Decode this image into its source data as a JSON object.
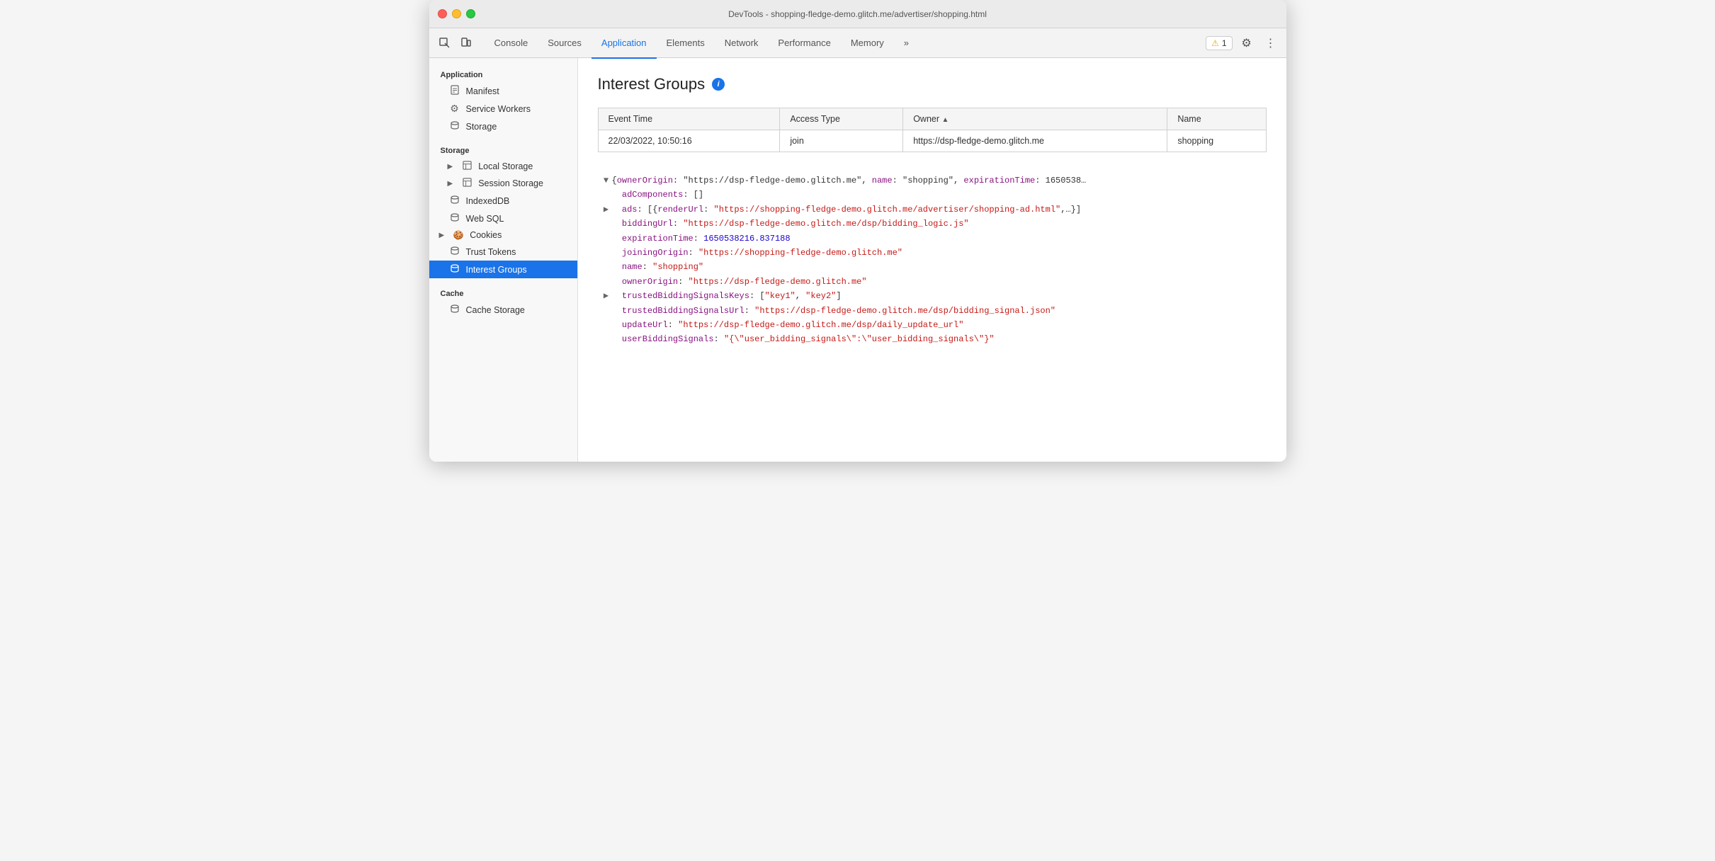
{
  "window": {
    "title": "DevTools - shopping-fledge-demo.glitch.me/advertiser/shopping.html"
  },
  "tabs": [
    {
      "id": "console",
      "label": "Console",
      "active": false
    },
    {
      "id": "sources",
      "label": "Sources",
      "active": false
    },
    {
      "id": "application",
      "label": "Application",
      "active": true
    },
    {
      "id": "elements",
      "label": "Elements",
      "active": false
    },
    {
      "id": "network",
      "label": "Network",
      "active": false
    },
    {
      "id": "performance",
      "label": "Performance",
      "active": false
    },
    {
      "id": "memory",
      "label": "Memory",
      "active": false
    }
  ],
  "toolbar": {
    "more_label": "»",
    "warning_count": "1",
    "warning_icon": "⚠"
  },
  "sidebar": {
    "app_section": "Application",
    "items_app": [
      {
        "id": "manifest",
        "label": "Manifest",
        "icon": "📄",
        "indent": 1
      },
      {
        "id": "service-workers",
        "label": "Service Workers",
        "icon": "⚙",
        "indent": 1
      },
      {
        "id": "storage",
        "label": "Storage",
        "icon": "🗃",
        "indent": 1
      }
    ],
    "storage_section": "Storage",
    "items_storage": [
      {
        "id": "local-storage",
        "label": "Local Storage",
        "icon": "▦",
        "indent": 2,
        "arrow": true
      },
      {
        "id": "session-storage",
        "label": "Session Storage",
        "icon": "▦",
        "indent": 2,
        "arrow": true
      },
      {
        "id": "indexeddb",
        "label": "IndexedDB",
        "icon": "🗃",
        "indent": 1
      },
      {
        "id": "web-sql",
        "label": "Web SQL",
        "icon": "🗃",
        "indent": 1
      },
      {
        "id": "cookies",
        "label": "Cookies",
        "icon": "🍪",
        "indent": 1,
        "arrow": true
      },
      {
        "id": "trust-tokens",
        "label": "Trust Tokens",
        "icon": "🗃",
        "indent": 1
      },
      {
        "id": "interest-groups",
        "label": "Interest Groups",
        "icon": "🗃",
        "indent": 1,
        "active": true
      }
    ],
    "cache_section": "Cache",
    "items_cache": [
      {
        "id": "cache-storage",
        "label": "Cache Storage",
        "icon": "🗃",
        "indent": 1
      }
    ]
  },
  "page": {
    "title": "Interest Groups",
    "info_tooltip": "i"
  },
  "table": {
    "headers": [
      {
        "id": "event-time",
        "label": "Event Time",
        "sorted": false
      },
      {
        "id": "access-type",
        "label": "Access Type",
        "sorted": false
      },
      {
        "id": "owner",
        "label": "Owner",
        "sorted": true,
        "sort_dir": "▲"
      },
      {
        "id": "name",
        "label": "Name",
        "sorted": false
      }
    ],
    "rows": [
      {
        "event_time": "22/03/2022, 10:50:16",
        "access_type": "join",
        "owner": "https://dsp-fledge-demo.glitch.me",
        "name": "shopping"
      }
    ]
  },
  "json_viewer": {
    "lines": [
      {
        "indent": 0,
        "toggle": "▼",
        "content_plain": "{",
        "key": "ownerOrigin",
        "val": "",
        "type": "header",
        "raw": "▼ {ownerOrigin: \"https://dsp-fledge-demo.glitch.me\", name: \"shopping\", expirationTime: 1650538…"
      },
      {
        "indent": 1,
        "toggle": " ",
        "key": "adComponents",
        "sep": ": ",
        "val": "[]",
        "val_type": "plain",
        "raw": "  adComponents: []"
      },
      {
        "indent": 1,
        "toggle": "▶",
        "key": "ads",
        "sep": ": ",
        "val": "[{renderUrl: \"https://shopping-fledge-demo.glitch.me/advertiser/shopping-ad.html\",…}]",
        "val_type": "plain",
        "raw": "▶ ads: [{renderUrl: \"https://shopping-fledge-demo.glitch.me/advertiser/shopping-ad.html\",…}]"
      },
      {
        "indent": 1,
        "toggle": " ",
        "key": "biddingUrl",
        "sep": ": ",
        "val": "\"https://dsp-fledge-demo.glitch.me/dsp/bidding_logic.js\"",
        "val_type": "str",
        "raw": "  biddingUrl: \"https://dsp-fledge-demo.glitch.me/dsp/bidding_logic.js\""
      },
      {
        "indent": 1,
        "toggle": " ",
        "key": "expirationTime",
        "sep": ": ",
        "val": "1650538216.837188",
        "val_type": "num",
        "raw": "  expirationTime: 1650538216.837188"
      },
      {
        "indent": 1,
        "toggle": " ",
        "key": "joiningOrigin",
        "sep": ": ",
        "val": "\"https://shopping-fledge-demo.glitch.me\"",
        "val_type": "str",
        "raw": "  joiningOrigin: \"https://shopping-fledge-demo.glitch.me\""
      },
      {
        "indent": 1,
        "toggle": " ",
        "key": "name",
        "sep": ": ",
        "val": "\"shopping\"",
        "val_type": "str",
        "raw": "  name: \"shopping\""
      },
      {
        "indent": 1,
        "toggle": " ",
        "key": "ownerOrigin",
        "sep": ": ",
        "val": "\"https://dsp-fledge-demo.glitch.me\"",
        "val_type": "str",
        "raw": "  ownerOrigin: \"https://dsp-fledge-demo.glitch.me\""
      },
      {
        "indent": 1,
        "toggle": "▶",
        "key": "trustedBiddingSignalsKeys",
        "sep": ": ",
        "val": "[\"key1\", \"key2\"]",
        "val_type": "plain",
        "raw": "▶ trustedBiddingSignalsKeys: [\"key1\", \"key2\"]"
      },
      {
        "indent": 1,
        "toggle": " ",
        "key": "trustedBiddingSignalsUrl",
        "sep": ": ",
        "val": "\"https://dsp-fledge-demo.glitch.me/dsp/bidding_signal.json\"",
        "val_type": "str",
        "raw": "  trustedBiddingSignalsUrl: \"https://dsp-fledge-demo.glitch.me/dsp/bidding_signal.json\""
      },
      {
        "indent": 1,
        "toggle": " ",
        "key": "updateUrl",
        "sep": ": ",
        "val": "\"https://dsp-fledge-demo.glitch.me/dsp/daily_update_url\"",
        "val_type": "str",
        "raw": "  updateUrl: \"https://dsp-fledge-demo.glitch.me/dsp/daily_update_url\""
      },
      {
        "indent": 1,
        "toggle": " ",
        "key": "userBiddingSignals",
        "sep": ": ",
        "val": "\"{\\\"user_bidding_signals\\\":\\\"user_bidding_signals\\\"}\"",
        "val_type": "str",
        "raw": "  userBiddingSignals: \"{\\\"user_bidding_signals\\\":\\\"user_bidding_signals\\\"}\""
      }
    ]
  }
}
